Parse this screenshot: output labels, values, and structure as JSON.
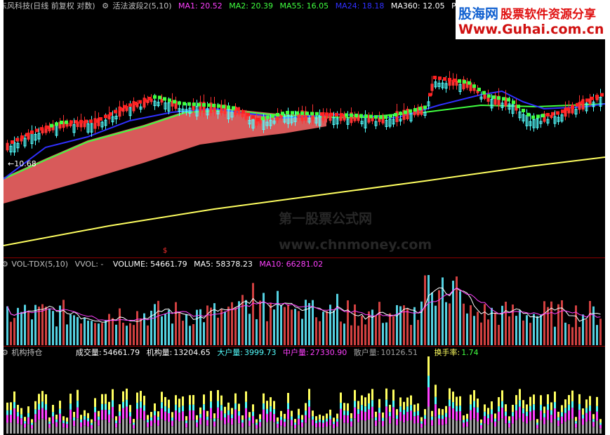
{
  "main": {
    "stock_title": "东风科技(日线 前复权 对数)",
    "indicator_icon": "gear-icon",
    "indicator_name": "活法波段2(5,10)",
    "ma1": "MA1: 20.52",
    "ma2": "MA2: 20.39",
    "ma55": "MA55: 16.05",
    "ma24": "MA24: 18.18",
    "ma360": "MA360: 12.05",
    "pm": "PM",
    "low_marker": "←10.68",
    "watermark_line1": "第一股票公式网",
    "watermark_line2": "www.chnmoney.com",
    "dollar": "$"
  },
  "volume_panel": {
    "title": "VOL-TDX(5,10)",
    "vvol": "VVOL: -",
    "volume": "VOLUME: 54661.79",
    "ma5": "MA5: 58378.23",
    "ma10": "MA10: 66281.02"
  },
  "holding_panel": {
    "title": "机构持仓",
    "chengjiao_label": "成交量:",
    "chengjiao_value": "54661.79",
    "jigou_label": "机构量:",
    "jigou_value": "13204.65",
    "dahu_label": "大户量:",
    "dahu_value": "3999.73",
    "zhonghu_label": "中户量:",
    "zhonghu_value": "27330.90",
    "sanhu_label": "散户量:",
    "sanhu_value": "10126.51",
    "huanshou_label": "换手率:",
    "huanshou_value": "1.74"
  },
  "logo": {
    "name_part1": "股海网",
    "name_part2": "股票软件资源分享",
    "url": "Www.Guhai.com.cn"
  },
  "colors": {
    "ma1": "#ff40ff",
    "ma2": "#40ff40",
    "ma55": "#40ff40",
    "ma24": "#3030ff",
    "ma360": "#ffffff",
    "up": "#ff3232",
    "down": "#54ffff",
    "ribbon": "#d85a5a",
    "yellow": "#ffff60"
  }
}
